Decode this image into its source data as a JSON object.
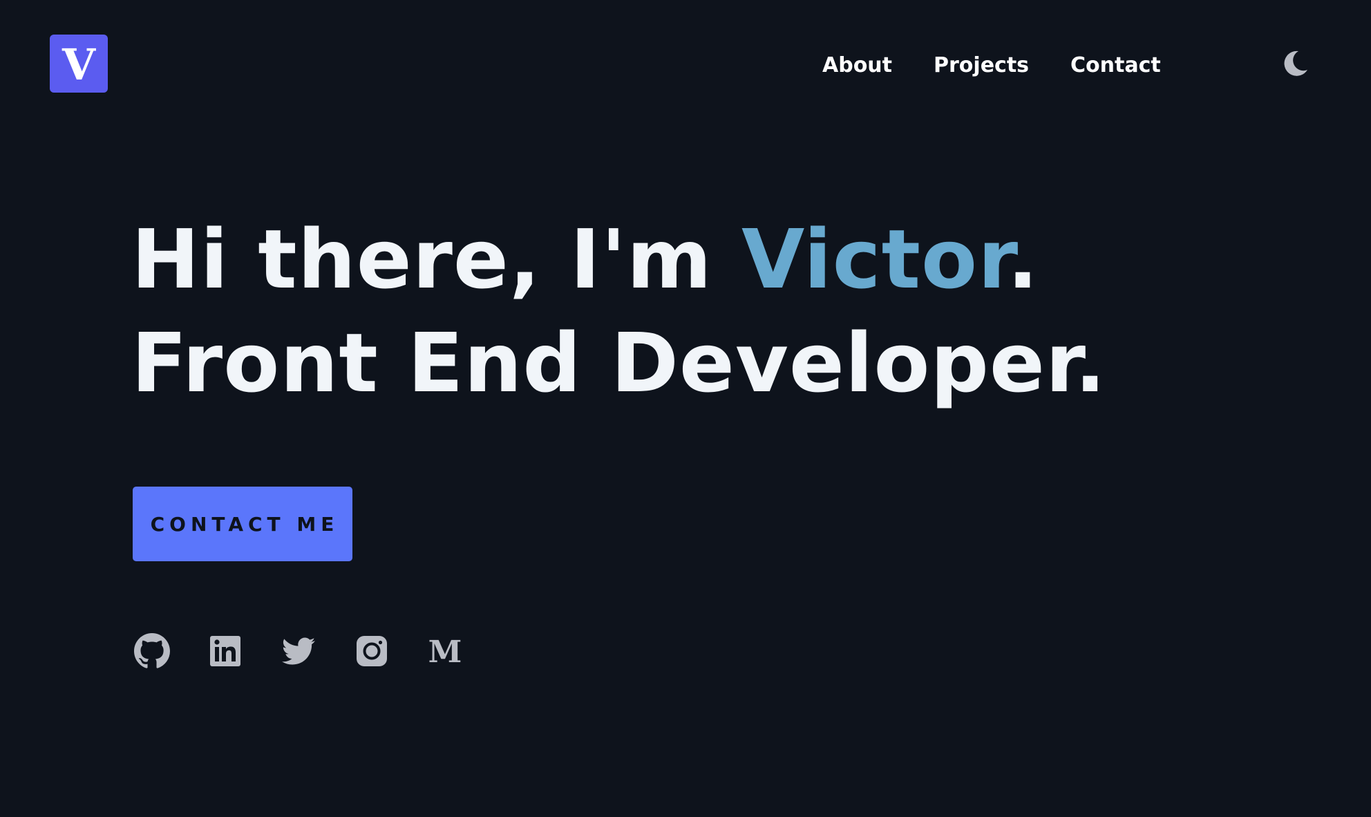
{
  "header": {
    "logo_letter": "V",
    "nav": [
      {
        "label": "About"
      },
      {
        "label": "Projects"
      },
      {
        "label": "Contact"
      }
    ],
    "theme_toggle_icon": "moon-icon"
  },
  "hero": {
    "line1_prefix": "Hi there, I'm ",
    "name": "Victor",
    "line1_suffix": ".",
    "line2": "Front End Developer."
  },
  "cta": {
    "label": "CONTACT ME"
  },
  "socials": [
    {
      "icon": "github-icon"
    },
    {
      "icon": "linkedin-icon"
    },
    {
      "icon": "twitter-icon"
    },
    {
      "icon": "instagram-icon"
    },
    {
      "icon": "medium-icon",
      "glyph": "M"
    }
  ],
  "colors": {
    "background": "#0e131c",
    "logo_bg": "#5b5cf0",
    "accent_name": "#68a9cf",
    "button_bg": "#5b76fb",
    "icon_gray": "#b9bcc4",
    "text": "#f1f5f9"
  }
}
